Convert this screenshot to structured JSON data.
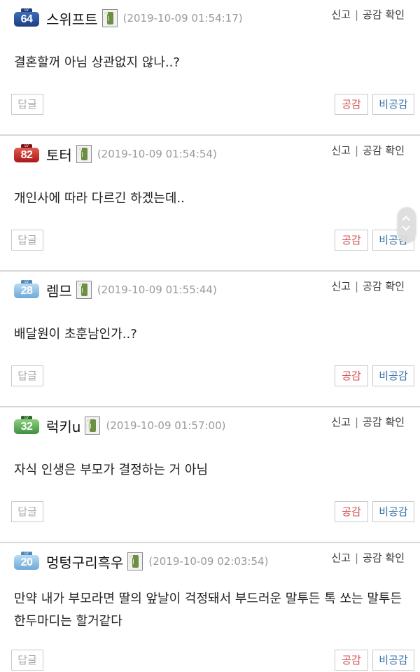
{
  "common": {
    "report_label": "신고",
    "separator": "|",
    "agree_check_label": "공감 확인",
    "reply_label": "답글",
    "agree_label": "공감",
    "disagree_label": "비공감"
  },
  "comments": [
    {
      "level": "64",
      "level_tag": "LV",
      "level_color": "#1c3f80",
      "nickname": "스위프트",
      "timestamp": "(2019-10-09 01:54:17)",
      "text": "결혼할꺼 아님 상관없지 않나..?"
    },
    {
      "level": "82",
      "level_tag": "LV",
      "level_color": "#a81818",
      "nickname": "토터",
      "timestamp": "(2019-10-09 01:54:54)",
      "text": "개인사에 따라 다르긴 하겠는데.."
    },
    {
      "level": "28",
      "level_tag": "LV",
      "level_color": "#6ea8d6",
      "nickname": "렘므",
      "timestamp": "(2019-10-09 01:55:44)",
      "text": "배달원이 초훈남인가..?"
    },
    {
      "level": "32",
      "level_tag": "LV",
      "level_color": "#3f8f3f",
      "nickname": "럭키u",
      "timestamp": "(2019-10-09 01:57:00)",
      "text": "자식 인생은 부모가 결정하는 거 아님"
    },
    {
      "level": "20",
      "level_tag": "LV",
      "level_color": "#6ea8d6",
      "nickname": "멍텅구리흑우",
      "timestamp": "(2019-10-09 02:03:54)",
      "text": "만약 내가 부모라면 딸의 앞날이 걱정돼서 부드러운 말투든 톡 쏘는 말투든 한두마디는 할거같다"
    }
  ]
}
